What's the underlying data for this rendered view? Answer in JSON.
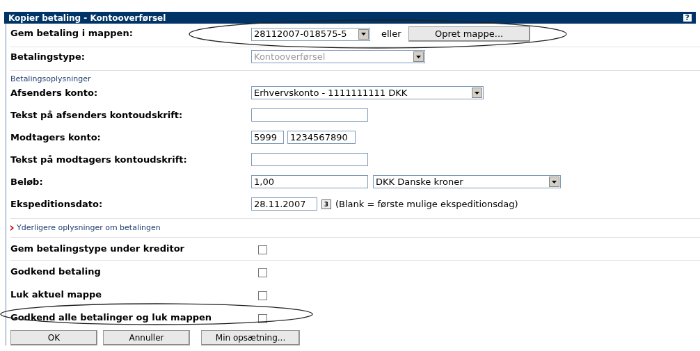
{
  "window": {
    "title": "Kopier betaling - Kontooverførsel",
    "help": "?"
  },
  "top_rows": [
    {
      "label": "Gem betaling i mappen:",
      "kind": "folder",
      "select": {
        "value": "28112007-018575-5",
        "disabled": false
      },
      "or_text": "eller",
      "button": "Opret mappe..."
    },
    {
      "label": "Betalingstype:",
      "kind": "type",
      "select": {
        "value": "Kontooverførsel",
        "disabled": true
      }
    }
  ],
  "section_title": "Betalingsoplysninger",
  "fields": [
    {
      "label": "Afsenders konto:",
      "kind": "select",
      "value": "Erhvervskonto - 1111111111 DKK"
    },
    {
      "label": "Tekst på afsenders kontoudskrift:",
      "kind": "input"
    },
    {
      "label": "Modtagers konto:",
      "kind": "account",
      "reg": "5999",
      "account": "1234567890"
    },
    {
      "label": "Tekst på modtagers kontoudskrift:",
      "kind": "input"
    },
    {
      "label": "Beløb:",
      "kind": "amount",
      "value": "1,00",
      "currency": "DKK Danske kroner"
    },
    {
      "label": "Ekspeditionsdato:",
      "kind": "date",
      "value": "28.11.2007",
      "calendar_day": "3",
      "hint": "(Blank = første mulige ekspeditionsdag)"
    }
  ],
  "more_link": "Yderligere oplysninger om betalingen",
  "options": [
    {
      "label": "Gem betalingstype under kreditor",
      "checked": false,
      "highlighted": false
    },
    {
      "label": "Godkend betaling",
      "checked": false,
      "highlighted": false
    },
    {
      "label": "Luk aktuel mappe",
      "checked": false,
      "highlighted": false
    },
    {
      "label": "Godkend alle betalinger og luk mappen",
      "checked": false,
      "highlighted": true
    }
  ],
  "buttons": [
    "OK",
    "Annuller",
    "Min opsætning..."
  ]
}
